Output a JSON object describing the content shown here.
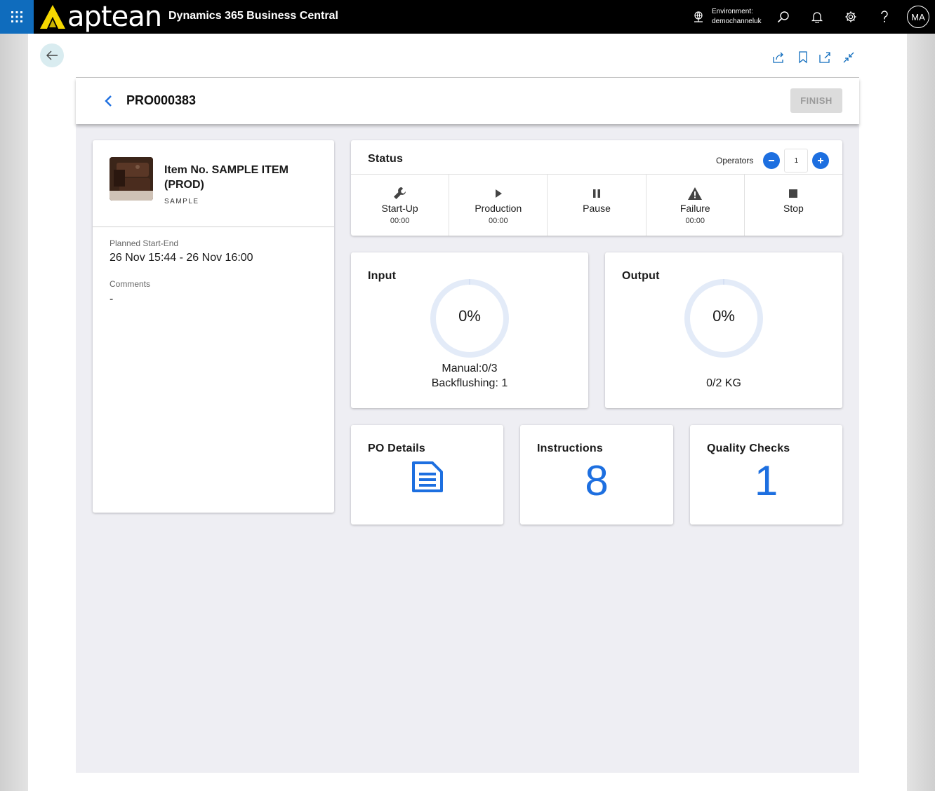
{
  "topbar": {
    "logo_text": "aptean",
    "app_title": "Dynamics 365 Business Central",
    "environment_label": "Environment:",
    "environment_value": "demochanneluk",
    "avatar_initials": "MA"
  },
  "header": {
    "title": "PRO000383",
    "finish_label": "FINISH"
  },
  "item": {
    "name": "Item No. SAMPLE ITEM (PROD)",
    "subtitle": "SAMPLE",
    "planned_label": "Planned Start-End",
    "planned_value": "26 Nov 15:44 - 26 Nov 16:00",
    "comments_label": "Comments",
    "comments_value": "-"
  },
  "status": {
    "title": "Status",
    "operators_label": "Operators",
    "operators_count": "1",
    "cells": [
      {
        "label": "Start-Up",
        "time": "00:00",
        "icon": "wrench-icon"
      },
      {
        "label": "Production",
        "time": "00:00",
        "icon": "play-icon"
      },
      {
        "label": "Pause",
        "time": "",
        "icon": "pause-icon"
      },
      {
        "label": "Failure",
        "time": "00:00",
        "icon": "warning-icon"
      },
      {
        "label": "Stop",
        "time": "",
        "icon": "stop-icon"
      }
    ]
  },
  "input": {
    "title": "Input",
    "percent": "0%",
    "manual": "Manual:0/3",
    "backflushing": "Backflushing: 1"
  },
  "output": {
    "title": "Output",
    "percent": "0%",
    "quantity": "0/2 KG"
  },
  "tiles": {
    "po_details": "PO Details",
    "instructions": "Instructions",
    "instructions_count": "8",
    "quality_checks": "Quality Checks",
    "quality_checks_count": "1"
  },
  "colors": {
    "accent": "#1d6fe0",
    "topbar": "#000000",
    "waffle": "#0f6cbd",
    "content_bg": "#eeeef3"
  }
}
